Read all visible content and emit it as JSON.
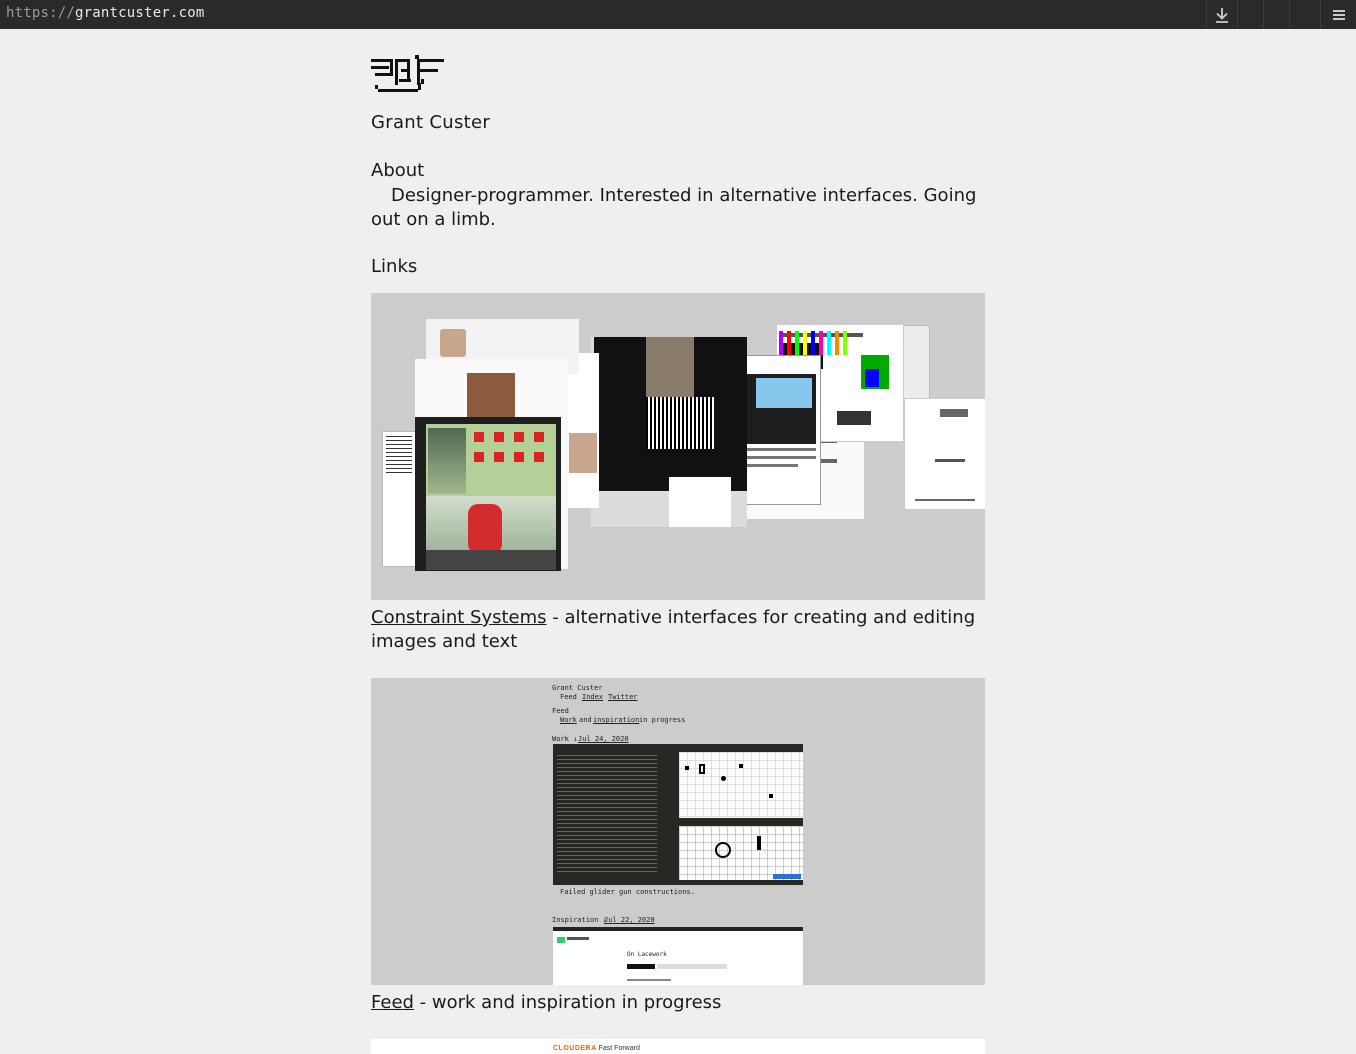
{
  "browser": {
    "url_protocol": "https://",
    "url_host": "grantcuster.com"
  },
  "site": {
    "name": "Grant Custer"
  },
  "about": {
    "heading": "About",
    "text": "Designer-programmer. Interested in alternative interfaces. Going out on a limb."
  },
  "links": {
    "heading": "Links",
    "projects": [
      {
        "title": "Constraint Systems",
        "description": " - alternative interfaces for creating and editing images and text"
      },
      {
        "title": "Feed",
        "description": " - work and inspiration in progress",
        "preview": {
          "name": "Grant Custer",
          "nav": [
            "Feed",
            "Index",
            "Twitter"
          ],
          "heading": "Feed",
          "intro_prefix": "Work",
          "intro_and": "and",
          "intro_link": "inspiration",
          "intro_suffix": "in progress",
          "work_label": "Work ↓",
          "work_date": "Jul 24, 2020",
          "caption": "Failed glider gun constructions.",
          "inspiration_label": "Inspiration ↓",
          "inspiration_date": "Jul 22, 2020",
          "inspiration_title": "On Lacework"
        }
      },
      {
        "preview": {
          "brand": "CLOUDERA",
          "product": "Fast Forward"
        }
      }
    ]
  }
}
